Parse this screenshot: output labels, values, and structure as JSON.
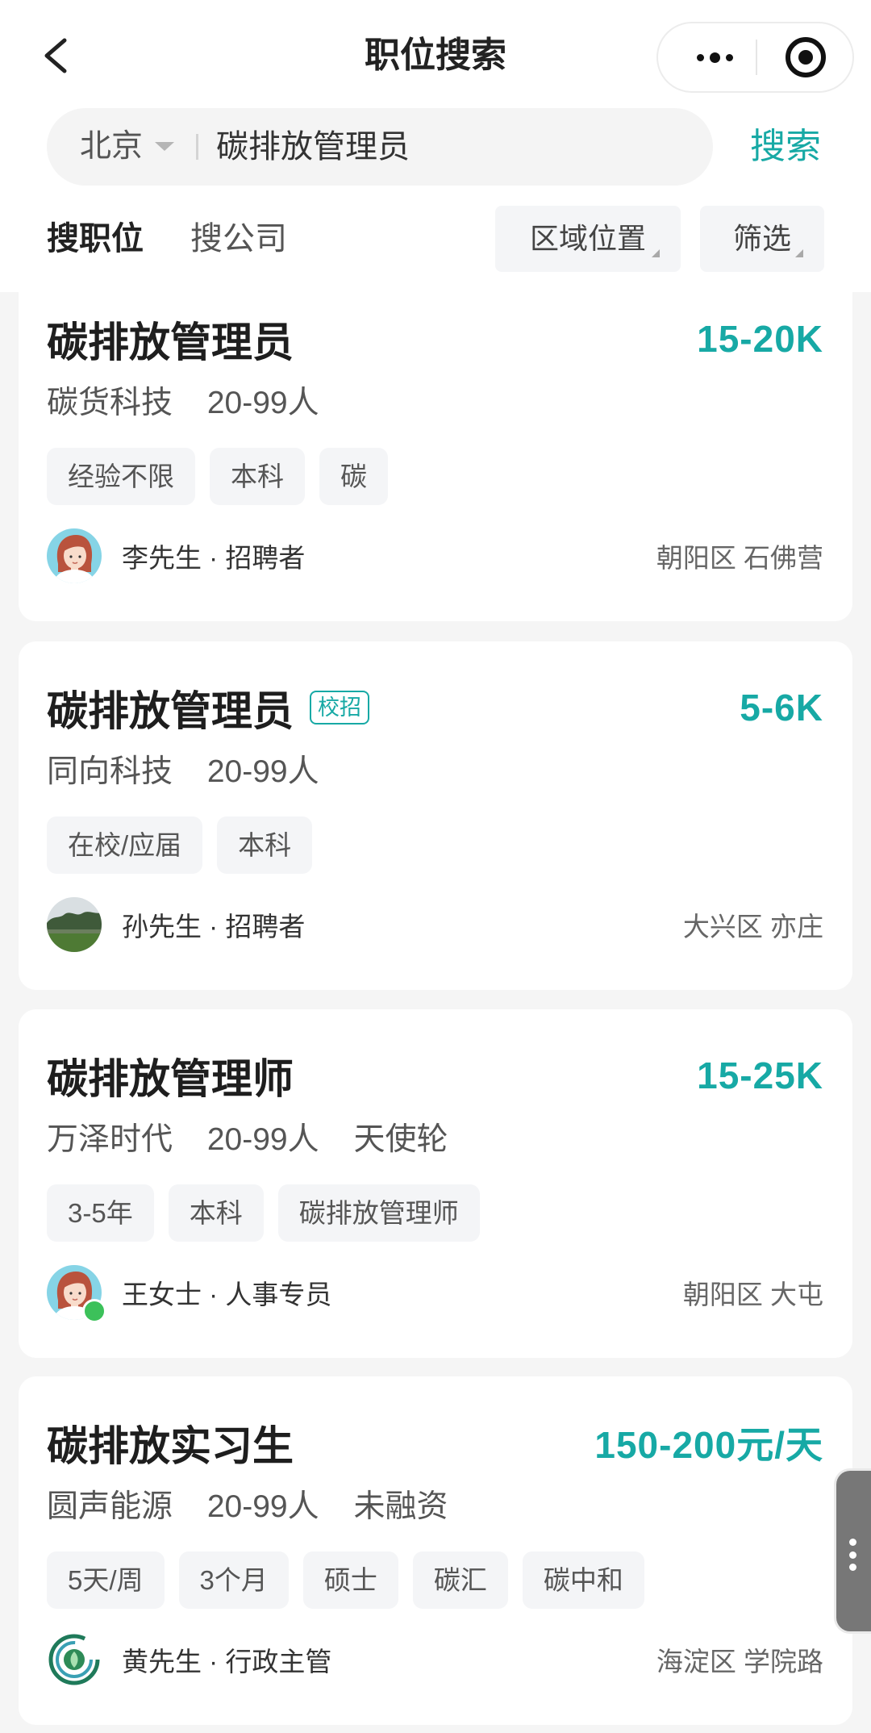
{
  "header": {
    "title": "职位搜索",
    "back_icon": "chevron-left-icon",
    "more_icon": "more-dots-icon",
    "close_icon": "target-close-icon"
  },
  "search": {
    "city": "北京",
    "query": "碳排放管理员",
    "button_label": "搜索"
  },
  "tabs": {
    "jobs_label": "搜职位",
    "companies_label": "搜公司"
  },
  "filters": {
    "area_label": "区域位置",
    "filter_label": "筛选"
  },
  "colors": {
    "accent": "#17a9a5",
    "tag_bg": "#f4f5f7",
    "page_bg": "#f5f5f5",
    "online": "#3cc15a"
  },
  "jobs": [
    {
      "title": "碳排放管理员",
      "salary": "15-20K",
      "company": "碳货科技",
      "size": "20-99人",
      "tags": [
        "经验不限",
        "本科",
        "碳"
      ],
      "recruiter": "李先生 · 招聘者",
      "location": "朝阳区 石佛营",
      "avatar": "cartoon-female-avatar"
    },
    {
      "title": "碳排放管理员",
      "badge": "校招",
      "salary": "5-6K",
      "company": "同向科技",
      "size": "20-99人",
      "tags": [
        "在校/应届",
        "本科"
      ],
      "recruiter": "孙先生 · 招聘者",
      "location": "大兴区 亦庄",
      "avatar": "landscape-photo-avatar"
    },
    {
      "title": "碳排放管理师",
      "salary": "15-25K",
      "company": "万泽时代",
      "size": "20-99人",
      "funding": "天使轮",
      "tags": [
        "3-5年",
        "本科",
        "碳排放管理师"
      ],
      "recruiter": "王女士 · 人事专员",
      "location": "朝阳区 大屯",
      "avatar": "cartoon-female-avatar",
      "online": true
    },
    {
      "title": "碳排放实习生",
      "salary": "150-200元/天",
      "company": "圆声能源",
      "size": "20-99人",
      "funding": "未融资",
      "tags": [
        "5天/周",
        "3个月",
        "硕士",
        "碳汇",
        "碳中和"
      ],
      "recruiter": "黄先生 · 行政主管",
      "location": "海淀区 学院路",
      "avatar": "green-logo-avatar"
    }
  ],
  "side_handle_icon": "vertical-dots-icon"
}
